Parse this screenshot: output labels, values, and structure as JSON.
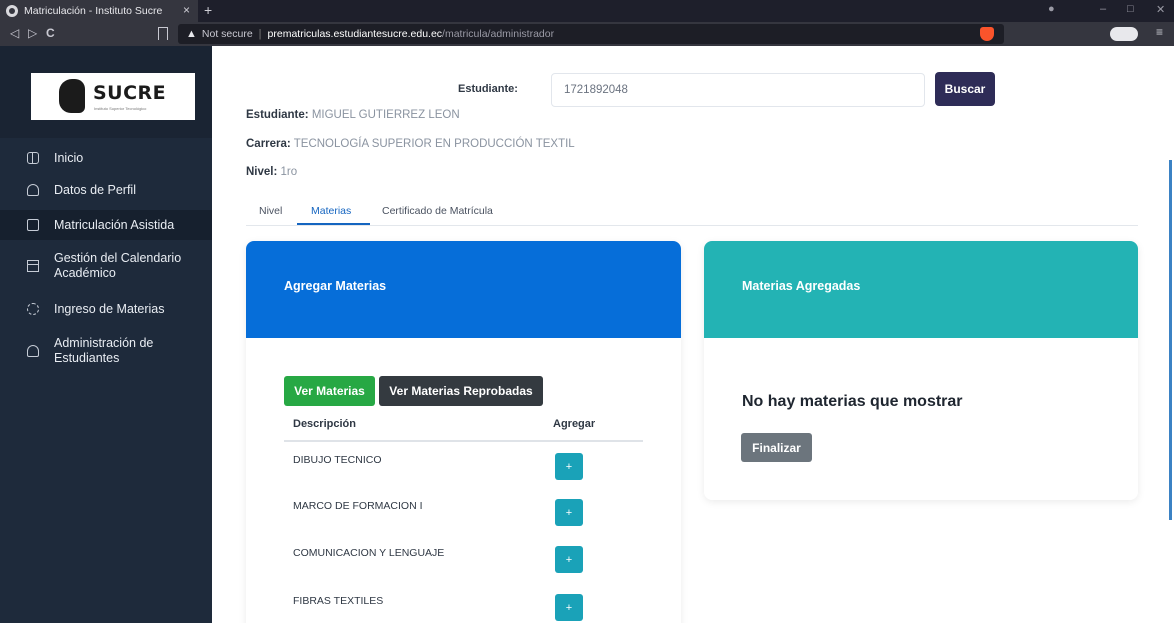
{
  "browser": {
    "tab_title": "Matriculación - Instituto Sucre",
    "tab_close": "×",
    "new_tab": "+",
    "not_secure": "Not secure",
    "url_host": "prematriculas.estudiantesucre.edu.ec",
    "url_path": "/matricula/administrador"
  },
  "logo": {
    "text": "SUCRE",
    "subtitle": "Instituto Superior Tecnológico"
  },
  "sidebar": {
    "items": [
      {
        "label": "Inicio",
        "icon": "grid-icon"
      },
      {
        "label": "Datos de Perfil",
        "icon": "user-icon"
      },
      {
        "label": "Matriculación Asistida",
        "icon": "register-icon",
        "active": true
      },
      {
        "label": "Gestión del Calendario Académico",
        "icon": "calendar-icon"
      },
      {
        "label": "Ingreso de Materias",
        "icon": "target-icon"
      },
      {
        "label": "Administración de Estudiantes",
        "icon": "user-icon"
      }
    ]
  },
  "search": {
    "label": "Estudiante:",
    "value": "1721892048",
    "button": "Buscar"
  },
  "student": {
    "name_label": "Estudiante:",
    "name": "MIGUEL GUTIERREZ LEON",
    "career_label": "Carrera:",
    "career": "TECNOLOGÍA SUPERIOR EN PRODUCCIÓN TEXTIL",
    "level_label": "Nivel:",
    "level": "1ro"
  },
  "tabs": [
    {
      "label": "Nivel"
    },
    {
      "label": "Materias",
      "active": true
    },
    {
      "label": "Certificado de Matrícula"
    }
  ],
  "add_card": {
    "title": "Agregar Materias",
    "btn_view": "Ver Materias",
    "btn_failed": "Ver Materias Reprobadas",
    "col_desc": "Descripción",
    "col_add": "Agregar",
    "add_symbol": "+",
    "rows": [
      "DIBUJO TECNICO",
      "MARCO DE FORMACION I",
      "COMUNICACION Y LENGUAJE",
      "FIBRAS TEXTILES"
    ]
  },
  "added_card": {
    "title": "Materias Agregadas",
    "empty": "No hay materias que mostrar",
    "finish": "Finalizar"
  },
  "colors": {
    "primary_blue": "#066ed9",
    "teal": "#23b3b4",
    "success": "#27a844",
    "dark": "#343a40",
    "info": "#1aa2b8",
    "sidebar": "#1e2a3b",
    "search_button": "#2e2c57"
  }
}
